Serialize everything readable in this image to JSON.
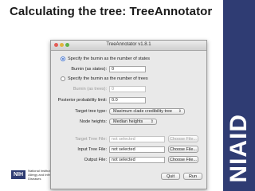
{
  "slide": {
    "title": "Calculating the tree: TreeAnnotator"
  },
  "brand": {
    "wordmark": "NIAID",
    "nih_mark": "NIH",
    "nih_text": "National Institute of Allergy and Infectious Diseases",
    "band_color": "#2f3c73"
  },
  "window": {
    "title": "TreeAnnotator v1.8.1",
    "burnin_states_radio": "Specify the burnin as the number of states",
    "burnin_states_label": "Burnin (as states):",
    "burnin_states_value": "0",
    "burnin_trees_radio": "Specify the burnin as the number of trees",
    "burnin_trees_label": "Burnin (as trees):",
    "burnin_trees_value": "0",
    "posterior_label": "Posterior probability limit:",
    "posterior_value": "0.0",
    "target_type_label": "Target tree type:",
    "target_type_value": "Maximum clade credibility tree",
    "node_heights_label": "Node heights:",
    "node_heights_value": "Median heights",
    "target_file_label": "Target Tree File:",
    "target_file_value": "not selected",
    "target_file_button": "Choose File...",
    "input_file_label": "Input Tree File:",
    "input_file_value": "not selected",
    "input_file_button": "Choose File...",
    "output_file_label": "Output File:",
    "output_file_value": "not selected",
    "output_file_button": "Choose File...",
    "quit_button": "Quit",
    "run_button": "Run"
  }
}
